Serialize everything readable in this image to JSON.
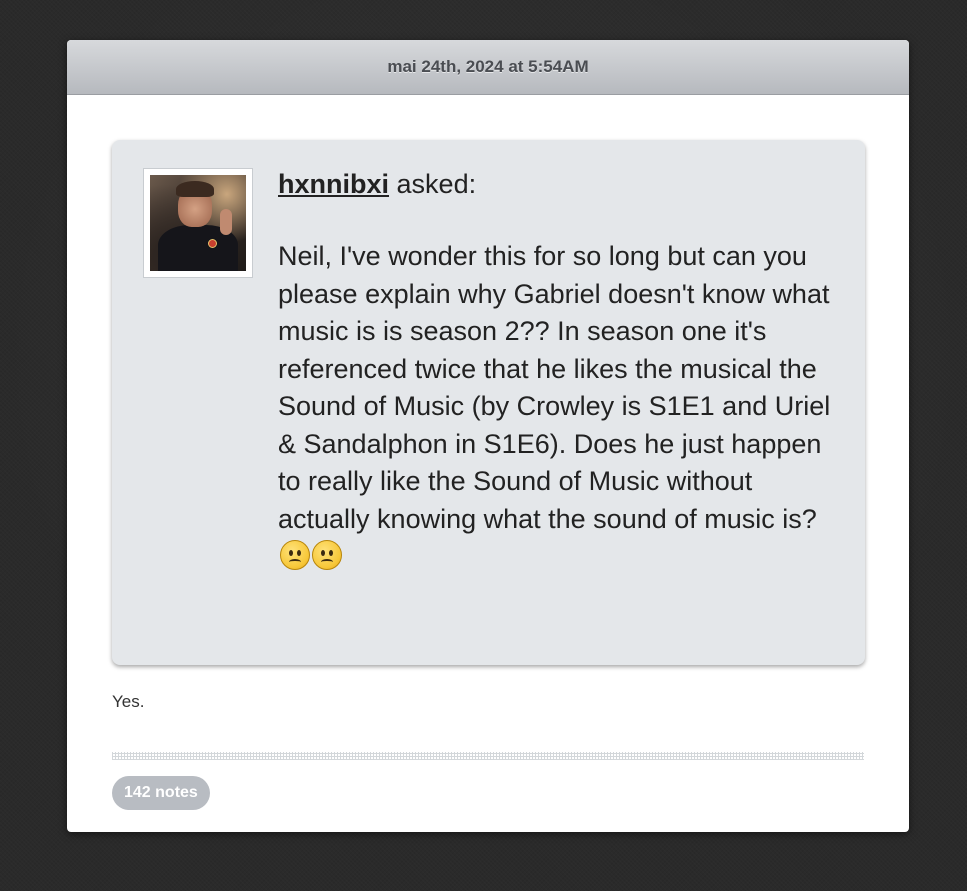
{
  "post": {
    "date": "mai 24th, 2024 at 5:54AM",
    "ask": {
      "asker_name": "hxnnibxi",
      "asked_suffix": "asked:",
      "question": "Neil, I've wonder this for so long but can you please explain why Gabriel doesn't know what music is is season 2?? In season one it's referenced twice that he likes the musical the Sound of Music (by Crowley is S1E1 and Uriel & Sandalphon in S1E6). Does he just happen to really like the Sound of Music without actually knowing what the sound of music is?",
      "emojis": [
        "frowning-face-icon",
        "frowning-face-icon"
      ]
    },
    "answer": "Yes.",
    "notes_label": "142 notes"
  },
  "colors": {
    "page_background": "#2a2a2a",
    "card_background": "#ffffff",
    "header_gradient_top": "#d7d9dc",
    "header_gradient_bottom": "#b6b9be",
    "ask_box_background": "#e4e7ea",
    "notes_pill_background": "#b8bcc2"
  }
}
